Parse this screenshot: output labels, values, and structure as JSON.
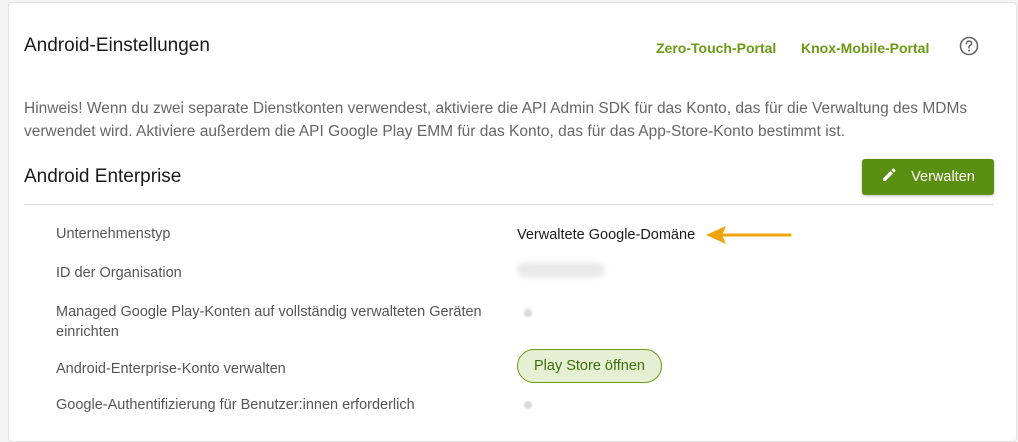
{
  "header": {
    "title": "Android-Einstellungen",
    "links": [
      "Zero-Touch-Portal",
      "Knox-Mobile-Portal"
    ],
    "help_icon": "question-circle-icon"
  },
  "hint": "Hinweis! Wenn du zwei separate Dienstkonten verwendest, aktiviere die API Admin SDK für das Konto, das für die Verwaltung des MDMs verwendet wird. Aktiviere außerdem die API Google Play EMM für das Konto, das für das App-Store-Konto bestimmt ist.",
  "section": {
    "title": "Android Enterprise",
    "manage_label": "Verwalten",
    "manage_icon": "pencil-icon"
  },
  "rows": [
    {
      "label": "Unternehmenstyp",
      "value": "Verwaltete Google-Domäne"
    },
    {
      "label": "ID der Organisation"
    },
    {
      "label": "Managed Google Play-Konten auf vollständig verwalteten Geräten einrichten"
    },
    {
      "label": "Android-Enterprise-Konto verwalten",
      "button": "Play Store öffnen"
    },
    {
      "label": "Google-Authentifizierung für Benutzer:innen erforderlich"
    }
  ],
  "colors": {
    "accent_green": "#5b8f12",
    "link_green": "#6a9a12",
    "annotation_arrow": "#f0a30a"
  }
}
